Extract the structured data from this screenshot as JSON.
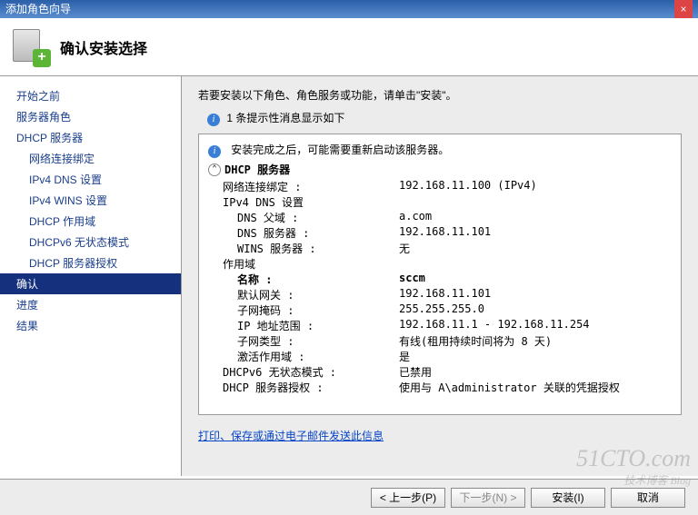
{
  "title": "添加角色向导",
  "header": {
    "title": "确认安装选择"
  },
  "sidebar": {
    "items": [
      {
        "label": "开始之前",
        "sub": false
      },
      {
        "label": "服务器角色",
        "sub": false
      },
      {
        "label": "DHCP 服务器",
        "sub": false
      },
      {
        "label": "网络连接绑定",
        "sub": true
      },
      {
        "label": "IPv4 DNS 设置",
        "sub": true
      },
      {
        "label": "IPv4 WINS 设置",
        "sub": true
      },
      {
        "label": "DHCP 作用域",
        "sub": true
      },
      {
        "label": "DHCPv6 无状态模式",
        "sub": true
      },
      {
        "label": "DHCP 服务器授权",
        "sub": true
      },
      {
        "label": "确认",
        "sub": false,
        "selected": true
      },
      {
        "label": "进度",
        "sub": false
      },
      {
        "label": "结果",
        "sub": false
      }
    ]
  },
  "content": {
    "instruction": "若要安装以下角色、角色服务或功能，请单击\"安装\"。",
    "info_count": "1 条提示性消息显示如下",
    "warn": "安装完成之后，可能需要重新启动该服务器。",
    "section_title": "DHCP 服务器",
    "rows": [
      {
        "k": "网络连接绑定 :",
        "v": "192.168.11.100 (IPv4)",
        "indent": 1
      },
      {
        "k": "IPv4 DNS 设置",
        "v": "",
        "indent": 1
      },
      {
        "k": "DNS 父域 :",
        "v": "a.com",
        "indent": 2
      },
      {
        "k": "DNS 服务器 :",
        "v": "192.168.11.101",
        "indent": 2
      },
      {
        "k": "WINS 服务器 :",
        "v": "无",
        "indent": 2
      },
      {
        "k": "作用域",
        "v": "",
        "indent": 1
      },
      {
        "k": "名称 :",
        "v": "sccm",
        "indent": 2,
        "bold": true
      },
      {
        "k": "默认网关 :",
        "v": "192.168.11.101",
        "indent": 2
      },
      {
        "k": "子网掩码 :",
        "v": "255.255.255.0",
        "indent": 2
      },
      {
        "k": "IP 地址范围 :",
        "v": "192.168.11.1 - 192.168.11.254",
        "indent": 2
      },
      {
        "k": "子网类型 :",
        "v": "有线(租用持续时间将为 8 天)",
        "indent": 2
      },
      {
        "k": "激活作用域 :",
        "v": "是",
        "indent": 2
      },
      {
        "k": "DHCPv6 无状态模式 :",
        "v": "已禁用",
        "indent": 1
      },
      {
        "k": "DHCP 服务器授权 :",
        "v": "使用与 A\\administrator 关联的凭据授权",
        "indent": 1
      }
    ],
    "link": "打印、保存或通过电子邮件发送此信息"
  },
  "footer": {
    "prev": "< 上一步(P)",
    "next": "下一步(N) >",
    "install": "安装(I)",
    "cancel": "取消"
  },
  "watermark": {
    "main": "51CTO.com",
    "sub": "技术博客 Blog"
  }
}
